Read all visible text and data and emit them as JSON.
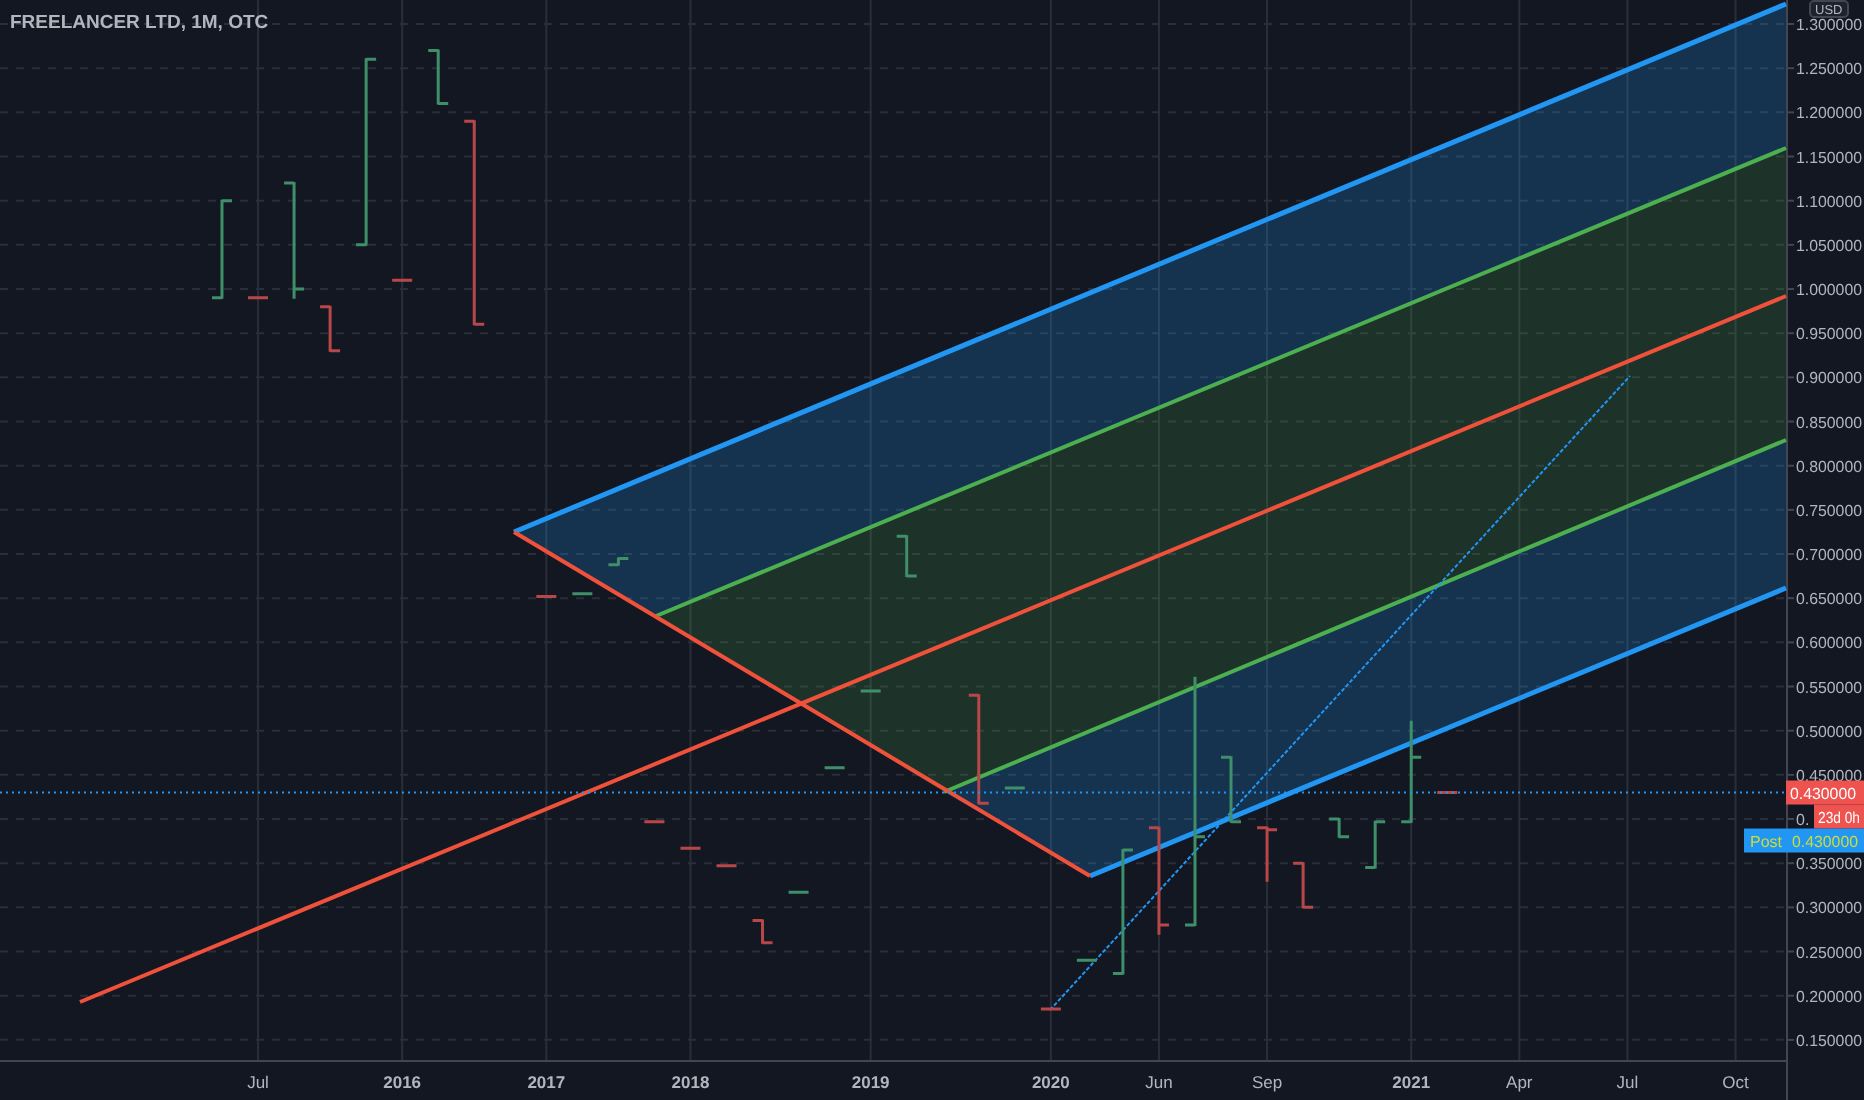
{
  "title": "FREELANCER LTD, 1M, OTC",
  "price_axis": {
    "currency": "USD",
    "labels": [
      "1.300000",
      "1.250000",
      "1.200000",
      "1.150000",
      "1.100000",
      "1.050000",
      "1.000000",
      "0.950000",
      "0.900000",
      "0.850000",
      "0.800000",
      "0.750000",
      "0.700000",
      "0.650000",
      "0.600000",
      "0.550000",
      "0.500000",
      "0.450000",
      "0.",
      "0.350000",
      "0.300000",
      "0.250000",
      "0.200000",
      "0.150000"
    ]
  },
  "time_axis": {
    "labels": [
      {
        "text": "Jul",
        "kind": "month"
      },
      {
        "text": "2016",
        "kind": "year"
      },
      {
        "text": "2017",
        "kind": "year"
      },
      {
        "text": "2018",
        "kind": "year"
      },
      {
        "text": "2019",
        "kind": "year"
      },
      {
        "text": "2020",
        "kind": "year"
      },
      {
        "text": "Jun",
        "kind": "month"
      },
      {
        "text": "Sep",
        "kind": "month"
      },
      {
        "text": "2021",
        "kind": "year"
      },
      {
        "text": "Apr",
        "kind": "month"
      },
      {
        "text": "Jul",
        "kind": "month"
      },
      {
        "text": "Oct",
        "kind": "month"
      }
    ]
  },
  "price_labels": [
    {
      "kind": "last",
      "text": "0.430000"
    },
    {
      "kind": "countdown",
      "text": "23d 0h"
    },
    {
      "kind": "post",
      "tag": "Post",
      "text": "0.430000"
    }
  ]
}
